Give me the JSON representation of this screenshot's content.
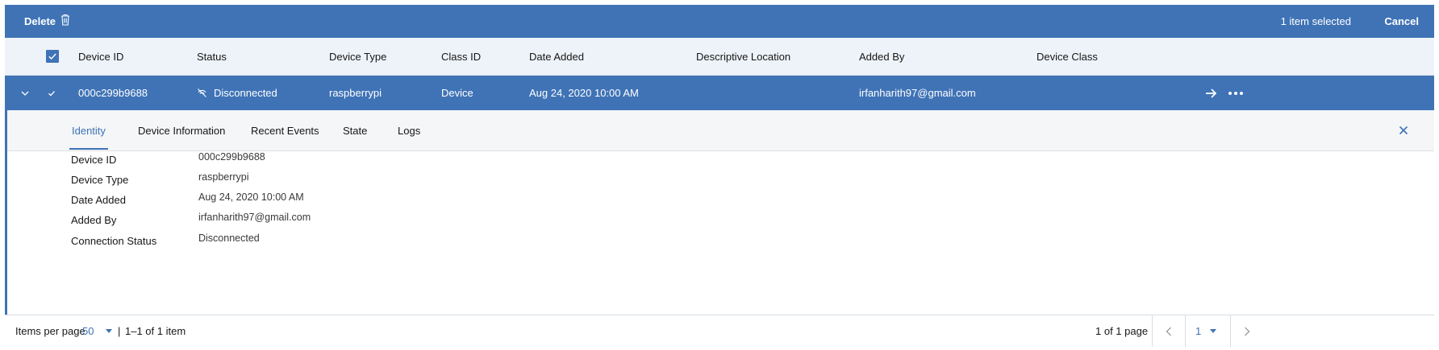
{
  "action_bar": {
    "delete_label": "Delete",
    "selected_text": "1 item selected",
    "cancel_label": "Cancel"
  },
  "table": {
    "columns": [
      "Device ID",
      "Status",
      "Device Type",
      "Class ID",
      "Date Added",
      "Descriptive Location",
      "Added By",
      "Device Class"
    ],
    "rows": [
      {
        "device_id": "000c299b9688",
        "status": "Disconnected",
        "device_type": "raspberrypi",
        "class_id": "Device",
        "date_added": "Aug 24, 2020 10:00 AM",
        "descriptive_location": "",
        "added_by": "irfanharith97@gmail.com",
        "device_class": ""
      }
    ]
  },
  "expanded": {
    "tabs": [
      "Identity",
      "Device Information",
      "Recent Events",
      "State",
      "Logs"
    ],
    "active_tab": "Identity",
    "fields": [
      {
        "label": "Device ID",
        "value": "000c299b9688"
      },
      {
        "label": "Device Type",
        "value": "raspberrypi"
      },
      {
        "label": "Date Added",
        "value": "Aug 24, 2020 10:00 AM"
      },
      {
        "label": "Added By",
        "value": "irfanharith97@gmail.com"
      },
      {
        "label": "Connection Status",
        "value": "Disconnected"
      }
    ]
  },
  "pagination": {
    "items_per_page_label": "Items per page",
    "items_per_page_value": "50",
    "range_text": "1–1 of 1 item",
    "page_of_text": "1 of 1 page",
    "current_page": "1"
  },
  "colors": {
    "accent": "#3f73b6",
    "header_bg": "#eef3f9",
    "tabs_bg": "#f4f6f8"
  },
  "icons": {
    "delete": "trash-icon",
    "status": "disconnected-icon",
    "row_expand": "chevron-down-icon",
    "row_select": "checkmark-icon",
    "row_go": "arrow-right-icon",
    "row_overflow": "overflow-menu-icon",
    "panel_close": "close-icon",
    "prev_page": "chevron-left-icon",
    "next_page": "chevron-right-icon"
  }
}
